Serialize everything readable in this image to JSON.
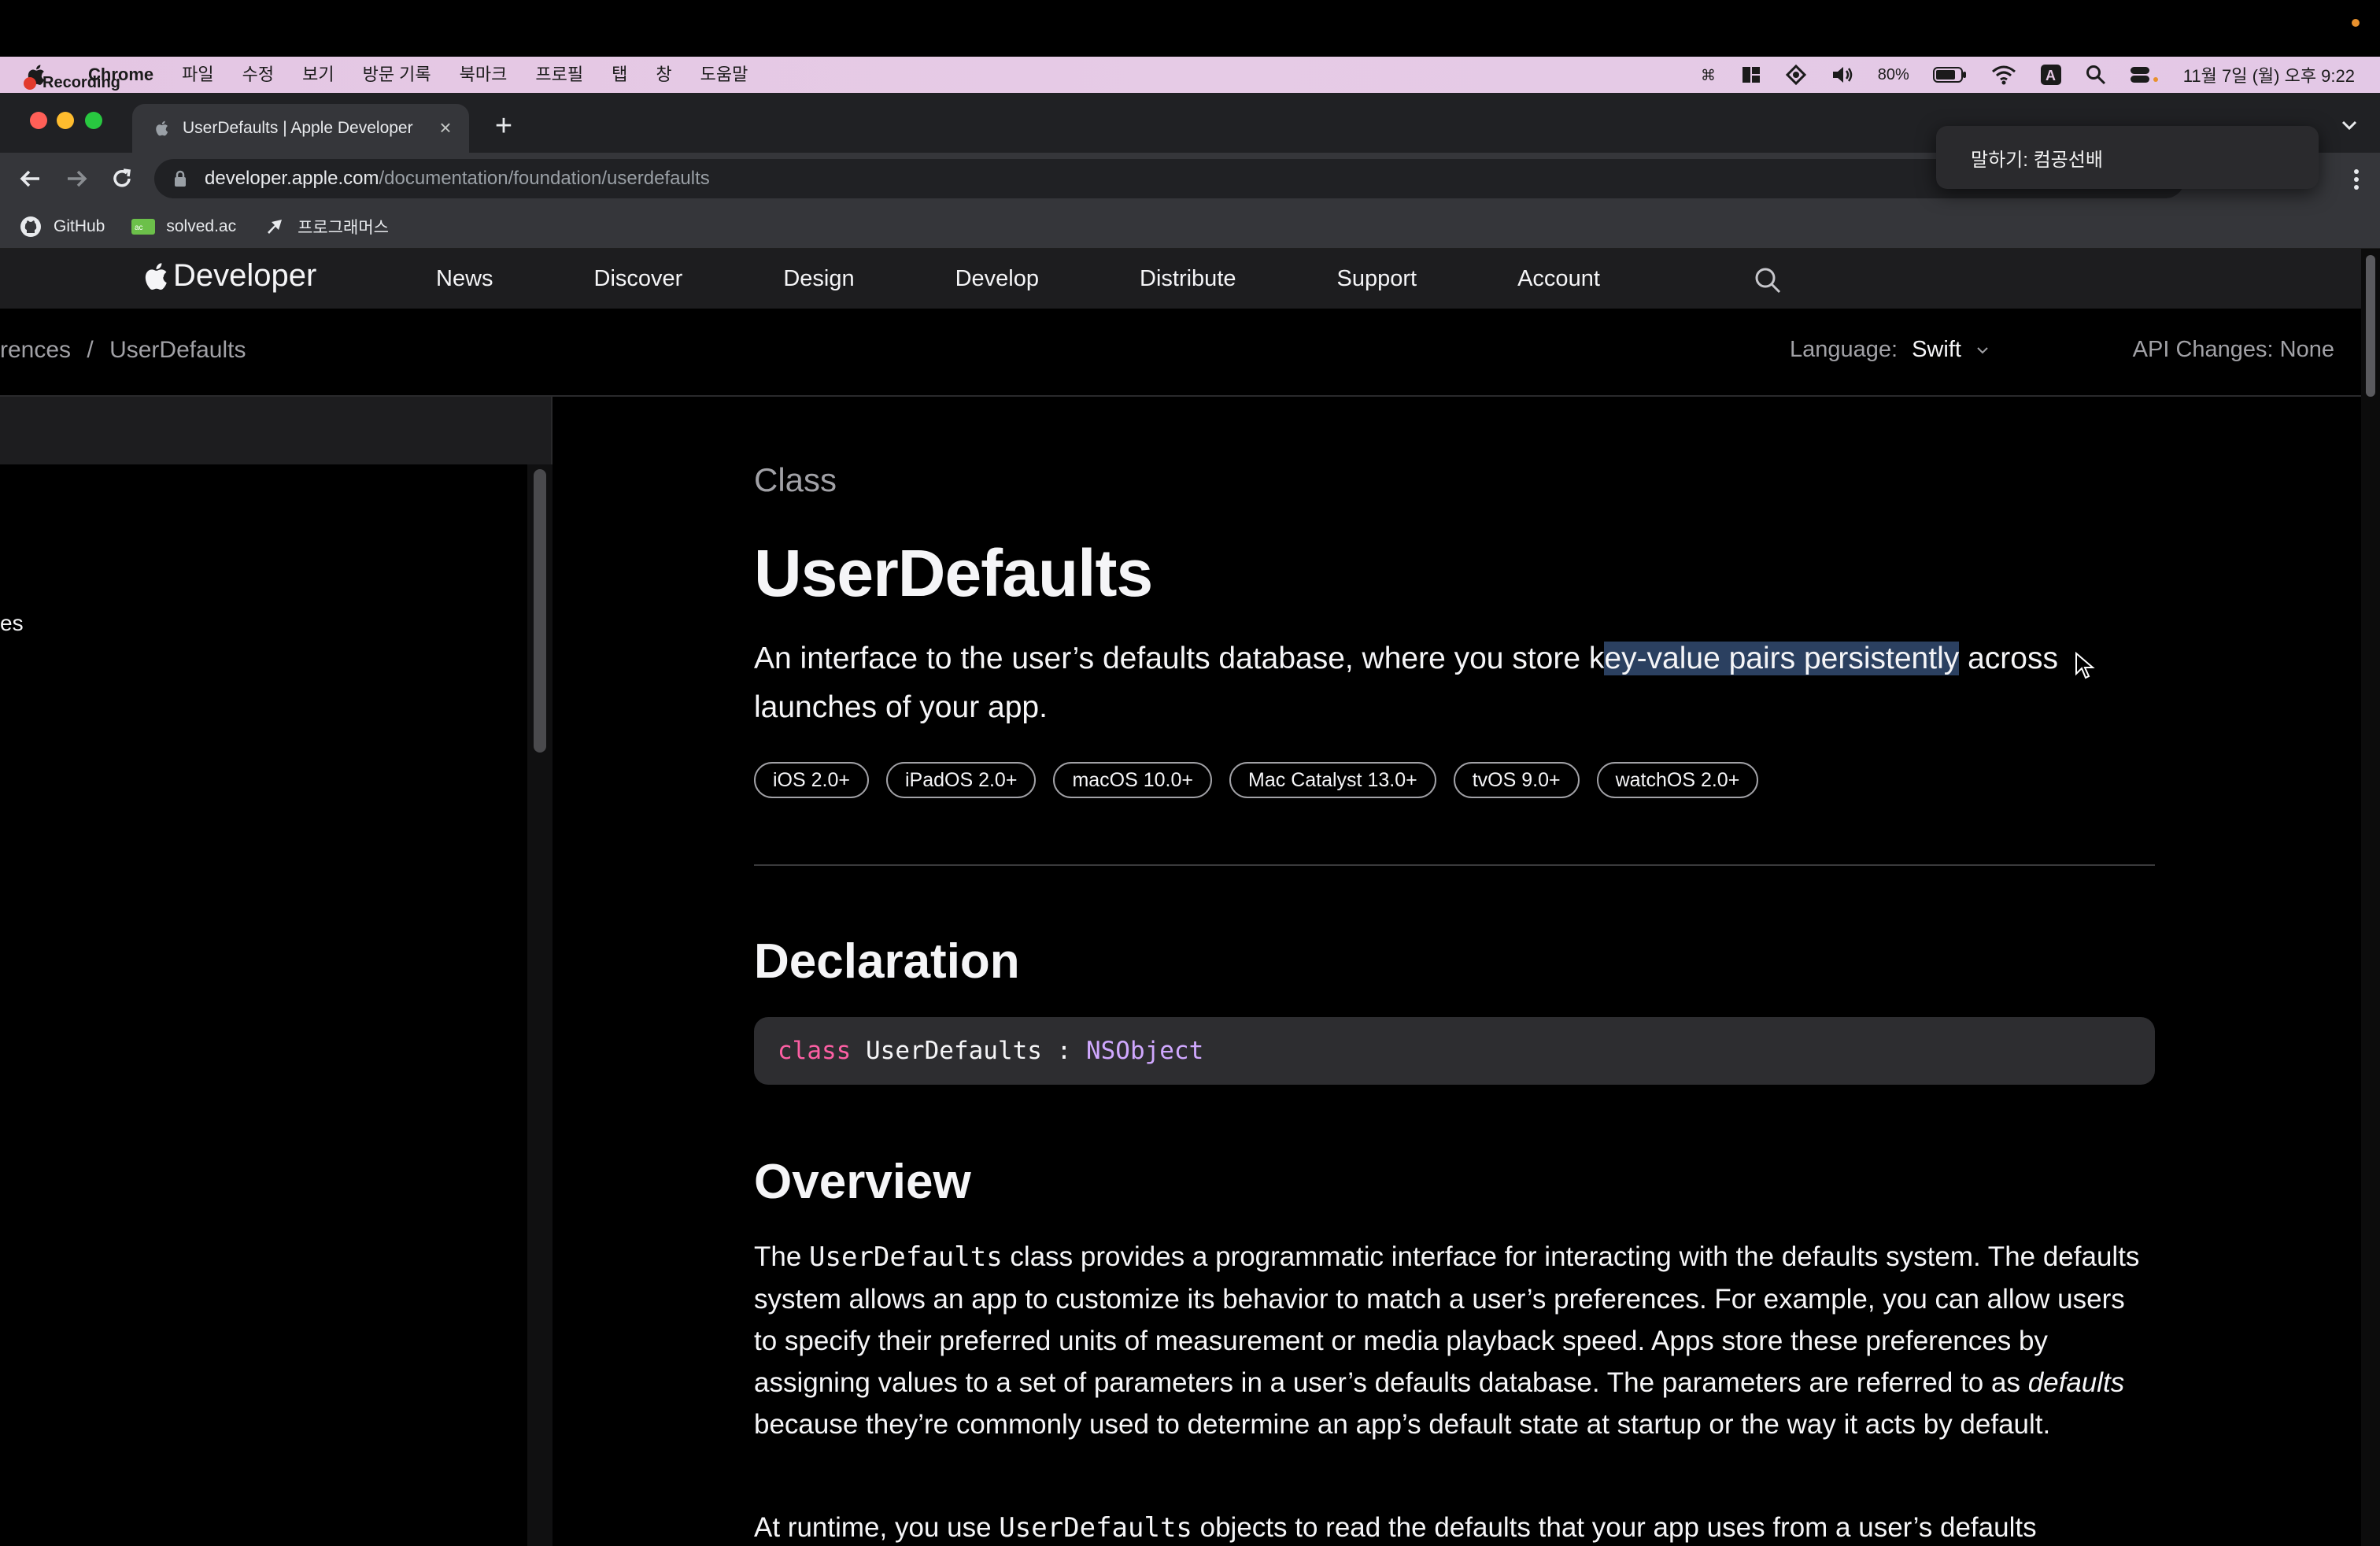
{
  "menubar": {
    "recording_label": "Recording",
    "app_name": "Chrome",
    "menus": [
      "파일",
      "수정",
      "보기",
      "방문 기록",
      "북마크",
      "프로필",
      "탭",
      "창",
      "도움말"
    ],
    "battery": "80%",
    "input_source": "A",
    "datetime": "11월 7일 (월) 오후 9:22"
  },
  "browser": {
    "tab_title": "UserDefaults | Apple Developer",
    "url_host": "developer.apple.com",
    "url_path": "/documentation/foundation/userdefaults",
    "bookmarks": [
      {
        "label": "GitHub",
        "icon": "github-icon"
      },
      {
        "label": "solved.ac",
        "icon": "solvedac-icon"
      },
      {
        "label": "프로그래머스",
        "icon": "programmers-icon"
      }
    ]
  },
  "notification": {
    "text": "말하기: 컴공선배"
  },
  "globalnav": {
    "brand": "Developer",
    "links": [
      "News",
      "Discover",
      "Design",
      "Develop",
      "Distribute",
      "Support",
      "Account"
    ]
  },
  "localnav": {
    "crumb_parent": "rences",
    "crumb_separator": "/",
    "crumb_current": "UserDefaults",
    "language_label": "Language:",
    "language_value": "Swift",
    "api_changes": "API Changes:  None"
  },
  "sidebar": {
    "visible_item": "es"
  },
  "doc": {
    "eyebrow": "Class",
    "title": "UserDefaults",
    "abstract_before": "An interface to the user’s defaults database, where you store k",
    "abstract_selected": "ey-value pairs persistently",
    "abstract_after": " across launches of your app.",
    "platforms": [
      "iOS 2.0+",
      "iPadOS 2.0+",
      "macOS 10.0+",
      "Mac Catalyst 13.0+",
      "tvOS 9.0+",
      "watchOS 2.0+"
    ],
    "declaration_heading": "Declaration",
    "code_keyword": "class",
    "code_name": " UserDefaults : ",
    "code_type": "NSObject",
    "overview_heading": "Overview",
    "p1_a": "The ",
    "p1_code": "UserDefaults",
    "p1_b": " class provides a programmatic interface for interacting with the defaults system. The defaults system allows an app to customize its behavior to match a user’s preferences. For example, you can allow users to specify their preferred units of measurement or media playback speed. Apps store these preferences by assigning values to a set of parameters in a user’s defaults database. The parameters are referred to as ",
    "p1_em": "defaults",
    "p1_c": " because they’re commonly used to determine an app’s default state at startup or the way it acts by default.",
    "p2_a": "At runtime, you use ",
    "p2_code": "UserDefaults",
    "p2_b": " objects to read the defaults that your app uses from a user’s defaults"
  },
  "colors": {
    "selection": "#2b4060",
    "code_keyword": "#fc5fa3",
    "code_type": "#d0a8ff",
    "menubar_bg": "#e4c6e3"
  }
}
